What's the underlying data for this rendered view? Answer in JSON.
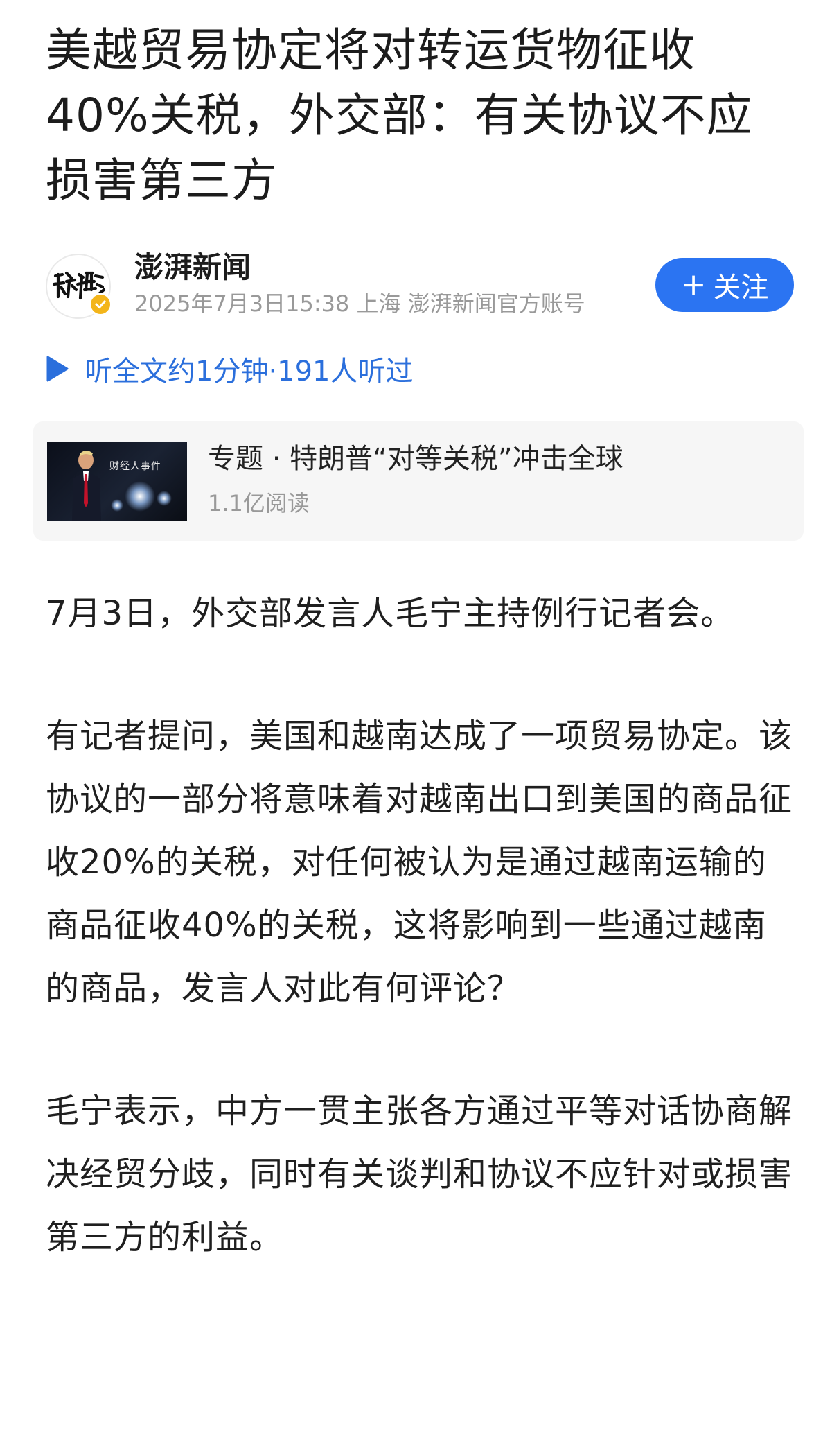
{
  "article": {
    "title": "美越贸易协定将对转运货物征收40%关税，外交部：有关协议不应损害第三方"
  },
  "author": {
    "name": "澎湃新闻",
    "meta": "2025年7月3日15:38 上海 澎湃新闻官方账号",
    "avatar_icon": "thepaper-logo-icon",
    "verified_icon": "verified-check-icon"
  },
  "follow_button": {
    "plus": "+",
    "label": "关注",
    "color": "#2b74f2"
  },
  "listen": {
    "icon": "play-icon",
    "label": "听全文约1分钟·191人听过",
    "color": "#2b6fdc"
  },
  "topic": {
    "title": "专题 · 特朗普“对等关税”冲击全球",
    "reads": "1.1亿阅读",
    "thumbnail_text": "财经人事件"
  },
  "body": {
    "paragraphs": [
      "7月3日，外交部发言人毛宁主持例行记者会。",
      "有记者提问，美国和越南达成了一项贸易协定。该协议的一部分将意味着对越南出口到美国的商品征收20%的关税，对任何被认为是通过越南运输的商品征收40%的关税，这将影响到一些通过越南的商品，发言人对此有何评论？",
      "毛宁表示，中方一贯主张各方通过平等对话协商解决经贸分歧，同时有关谈判和协议不应针对或损害第三方的利益。"
    ]
  }
}
